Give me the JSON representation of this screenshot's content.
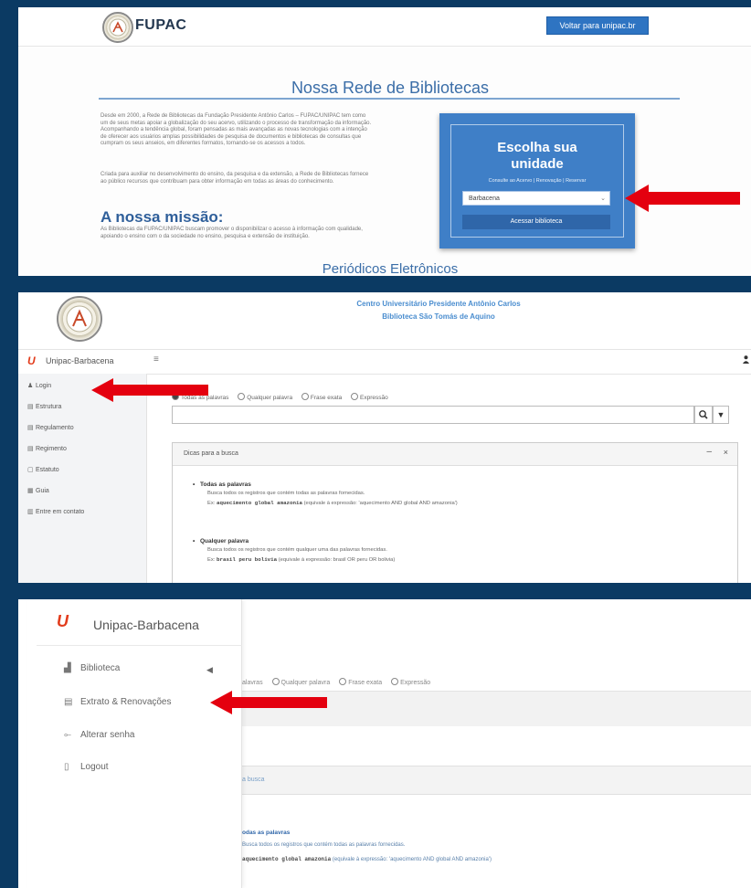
{
  "colors": {
    "frame": "#0b3a63",
    "accent_blue": "#3f7fc7",
    "arrow_red": "#e4000f",
    "uniapac_red": "#e23b1b"
  },
  "panel1": {
    "logo_text": "FUPAC",
    "back_button": "Voltar para unipac.br",
    "title": "Nossa Rede de Bibliotecas",
    "paragraph1": "Desde em 2000, a Rede de Bibliotecas da Fundação Presidente Antônio Carlos – FUPAC/UNIPAC tem como um de seus metas apoiar a globalização do seu acervo, utilizando o processo de transformação da informação. Acompanhando a tendência global, foram pensadas as mais avançadas as novas tecnologias com a intenção de oferecer aos usuários amplas possibilidades de pesquisa de documentos e bibliotecas de consultas que cumpram os seus anseios, em diferentes formatos, tornando-se os acessos a todos.",
    "paragraph2": "Criada para auxiliar no desenvolvimento do ensino, da pesquisa e da extensão, a Rede de Bibliotecas fornece ao público recursos que contribuam para obter informação em todas as áreas do conhecimento.",
    "mission_heading": "A nossa missão:",
    "paragraph3": "As Bibliotecas da FUPAC/UNIPAC buscam promover o disponibilizar o acesso à informação com qualidade, apoiando o ensino com o da sociedade no ensino, pesquisa e extensão de instituição.",
    "choose_title_line1": "Escolha sua",
    "choose_title_line2": "unidade",
    "choose_sub": "Consulte ao Acervo | Renovação | Reservar",
    "selected_unit": "Barbacena",
    "access_button": "Acessar biblioteca",
    "bottom_title": "Periódicos Eletrônicos"
  },
  "panel2": {
    "center_name": "Centro Universitário Presidente Antônio Carlos",
    "library_name": "Biblioteca São Tomás de Aquino",
    "brand": "Unipac-Barbacena",
    "menu_icon": "≡",
    "sidebar": [
      {
        "label": "Login",
        "icon": "user-icon"
      },
      {
        "label": "Estrutura",
        "icon": "document-icon"
      },
      {
        "label": "Regulamento",
        "icon": "document-icon"
      },
      {
        "label": "Regimento",
        "icon": "document-icon"
      },
      {
        "label": "Estatuto",
        "icon": "document-icon"
      },
      {
        "label": "Guia",
        "icon": "guide-icon"
      },
      {
        "label": "Entre em contato",
        "icon": "contact-icon"
      }
    ],
    "search_options": [
      "Todas as palavras",
      "Qualquer palavra",
      "Frase exata",
      "Expressão"
    ],
    "tips_title": "Dicas para a busca",
    "tip1_heading": "Todas as palavras",
    "tip1_text": "Busca todos os registros que contém todas as palavras fornecidas.",
    "tip1_example_prefix": "Ex:",
    "tip1_example_terms": "aquecimento global amazonia",
    "tip1_example_suffix": "(equivale à expressão: 'aquecimento AND global AND amazonia')",
    "tip2_heading": "Qualquer palavra",
    "tip2_text": "Busca todos os registros que contém qualquer uma das palavras fornecidas.",
    "tip2_example_prefix": "Ex:",
    "tip2_example_terms": "brasil peru bolivia",
    "tip2_example_suffix": "(equivale à expressão: brasil OR peru OR bolivia)"
  },
  "panel3": {
    "brand": "Unipac-Barbacena",
    "menu": [
      {
        "label": "Biblioteca",
        "icon": "library-icon"
      },
      {
        "label": "Extrato & Renovações",
        "icon": "list-icon"
      },
      {
        "label": "Alterar senha",
        "icon": "key-icon"
      },
      {
        "label": "Logout",
        "icon": "logout-icon"
      }
    ],
    "caret": "◀",
    "search_options": [
      "alavras",
      "Qualquer palavra",
      "Frase exata",
      "Expressão"
    ],
    "tips_label": "a busca",
    "tip1_heading": "odas as palavras",
    "tip1_text": "Busca todos os registros que contém todas as palavras fornecidas.",
    "tip1_example_terms": "aquecimento global amazonia",
    "tip1_example_suffix": "(equivale à expressão: 'aquecimento AND global AND amazonia')"
  }
}
